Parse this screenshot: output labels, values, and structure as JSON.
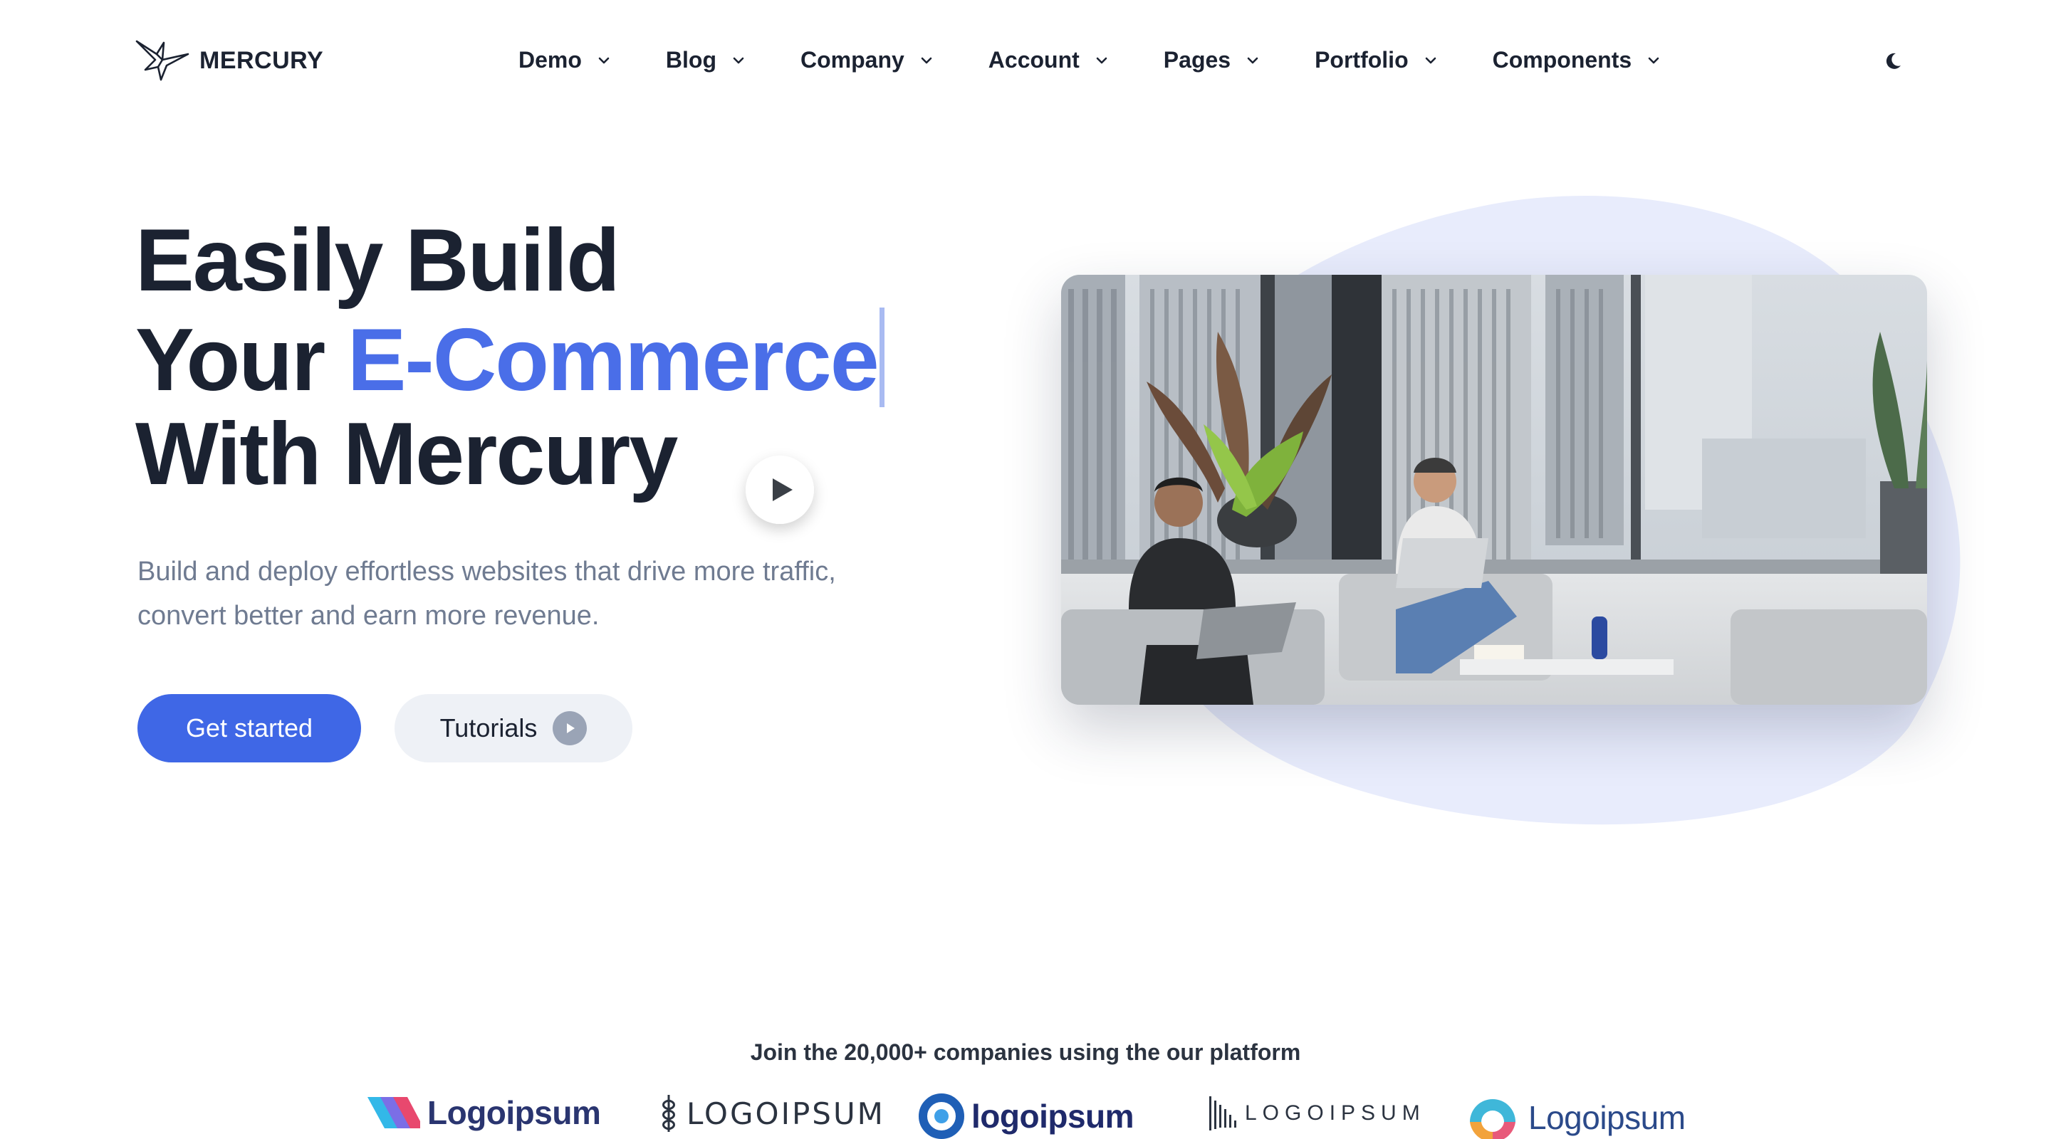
{
  "brand": {
    "name": "MERCURY"
  },
  "nav": {
    "items": [
      {
        "label": "Demo"
      },
      {
        "label": "Blog"
      },
      {
        "label": "Company"
      },
      {
        "label": "Account"
      },
      {
        "label": "Pages"
      },
      {
        "label": "Portfolio"
      },
      {
        "label": "Components"
      }
    ],
    "theme_toggle_icon": "moon-icon"
  },
  "hero": {
    "title_line1": "Easily Build",
    "title_line2_prefix": "Your ",
    "title_line2_accent": "E-Commerce",
    "title_line3": "With Mercury",
    "subtitle": "Build and deploy effortless websites that drive more traffic, convert better and earn more revenue.",
    "primary_button": "Get started",
    "secondary_button": "Tutorials"
  },
  "partners": {
    "text": "Join the 20,000+ companies using the our platform",
    "logos": [
      "Logoipsum",
      "LOGOIPSUM",
      "logoipsum",
      "LOGOIPSUM",
      "Logoipsum"
    ]
  },
  "colors": {
    "accent": "#4a6ee8",
    "button": "#3f67e6",
    "blob": "#e8ecfc",
    "heading": "#1b2231",
    "muted": "#6f7b91"
  }
}
